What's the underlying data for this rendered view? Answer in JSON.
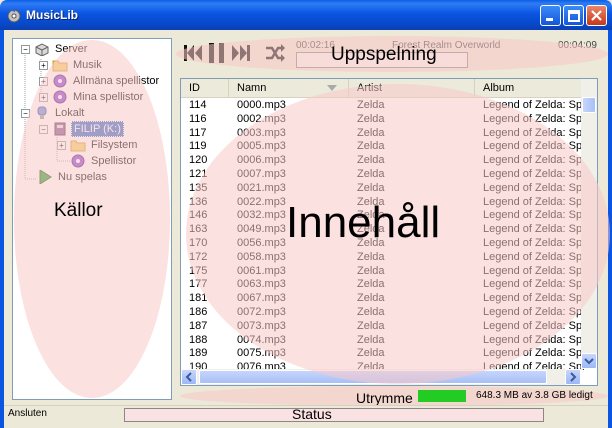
{
  "window": {
    "title": "MusicLib"
  },
  "sources": {
    "items": [
      {
        "label": "Server",
        "expander": "−",
        "icon": "server-icon"
      },
      {
        "label": "Musik",
        "expander": "+",
        "icon": "folder-icon"
      },
      {
        "label": "Allmäna spellistor",
        "expander": "+",
        "icon": "playlist-icon"
      },
      {
        "label": "Mina spellistor",
        "expander": "+",
        "icon": "playlist-icon"
      },
      {
        "label": "Lokalt",
        "expander": "−",
        "icon": "computer-icon"
      },
      {
        "label": "FILIP (K:)",
        "expander": "−",
        "icon": "device-icon",
        "selected": true
      },
      {
        "label": "Filsystem",
        "expander": "+",
        "icon": "folder-icon"
      },
      {
        "label": "Spellistor",
        "expander": "",
        "icon": "playlist-icon"
      },
      {
        "label": "Nu spelas",
        "expander": "",
        "icon": "play-icon"
      }
    ]
  },
  "player": {
    "elapsed": "00:02:16",
    "track": "Forest Realm Overworld",
    "total": "00:04:09",
    "progress": 0.55
  },
  "table": {
    "columns": [
      "ID",
      "Namn",
      "Artist",
      "Album"
    ],
    "rows": [
      [
        "114",
        "0000.mp3",
        "Zelda",
        "Legend of Zelda: Spi"
      ],
      [
        "116",
        "0002.mp3",
        "Zelda",
        "Legend of Zelda: Spi"
      ],
      [
        "117",
        "0003.mp3",
        "Zelda",
        "Legend of Zelda: Spi"
      ],
      [
        "119",
        "0005.mp3",
        "Zelda",
        "Legend of Zelda: Spi"
      ],
      [
        "120",
        "0006.mp3",
        "Zelda",
        "Legend of Zelda: Spi"
      ],
      [
        "121",
        "0007.mp3",
        "Zelda",
        "Legend of Zelda: Spi"
      ],
      [
        "135",
        "0021.mp3",
        "Zelda",
        "Legend of Zelda: Spi"
      ],
      [
        "136",
        "0022.mp3",
        "Zelda",
        "Legend of Zelda: Spi"
      ],
      [
        "146",
        "0032.mp3",
        "Zelda",
        "Legend of Zelda: Spi"
      ],
      [
        "163",
        "0049.mp3",
        "Zelda",
        "Legend of Zelda: Spi"
      ],
      [
        "170",
        "0056.mp3",
        "Zelda",
        "Legend of Zelda: Spi"
      ],
      [
        "172",
        "0058.mp3",
        "Zelda",
        "Legend of Zelda: Spi"
      ],
      [
        "175",
        "0061.mp3",
        "Zelda",
        "Legend of Zelda: Spi"
      ],
      [
        "177",
        "0063.mp3",
        "Zelda",
        "Legend of Zelda: Spi"
      ],
      [
        "181",
        "0067.mp3",
        "Zelda",
        "Legend of Zelda: Spi"
      ],
      [
        "186",
        "0072.mp3",
        "Zelda",
        "Legend of Zelda: Spi"
      ],
      [
        "187",
        "0073.mp3",
        "Zelda",
        "Legend of Zelda: Spi"
      ],
      [
        "188",
        "0074.mp3",
        "Zelda",
        "Legend of Zelda: Spi"
      ],
      [
        "189",
        "0075.mp3",
        "Zelda",
        "Legend of Zelda: Spi"
      ],
      [
        "190",
        "0076.mp3",
        "Zelda",
        "Legend of Zelda: Spi"
      ]
    ]
  },
  "storage": {
    "text": "648.3 MB av 3.8 GB ledigt",
    "fill_color": "#22cc22"
  },
  "statusbar": {
    "text": "Ansluten"
  },
  "overlays": {
    "sources_label": "Källor",
    "player_label": "Uppspelning",
    "content_label": "Innehåll",
    "space_label": "Utrymme",
    "status_label": "Status"
  }
}
